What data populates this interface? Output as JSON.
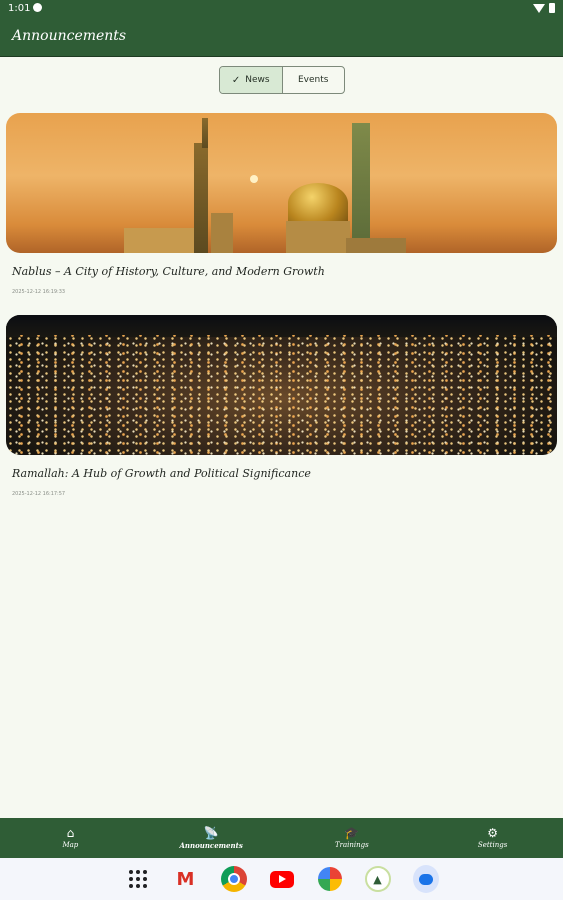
{
  "status_bar": {
    "time": "1:01"
  },
  "app_bar": {
    "title": "Announcements"
  },
  "segmented": {
    "options": [
      {
        "label": "News",
        "selected": true
      },
      {
        "label": "Events",
        "selected": false
      }
    ]
  },
  "feed": {
    "items": [
      {
        "title": "Nablus – A City of History, Culture, and Modern Growth",
        "date": "2025-12-12 16:19:33",
        "image": "mosque-sunset"
      },
      {
        "title": "Ramallah: A Hub of Growth and Political Significance",
        "date": "2025-12-12 16:17:57",
        "image": "city-night"
      }
    ]
  },
  "bottom_nav": {
    "items": [
      {
        "label": "Map",
        "icon": "home-icon",
        "active": false
      },
      {
        "label": "Announcements",
        "icon": "broadcast-icon",
        "active": true
      },
      {
        "label": "Trainings",
        "icon": "graduation-cap-icon",
        "active": false
      },
      {
        "label": "Settings",
        "icon": "gear-icon",
        "active": false
      }
    ]
  },
  "colors": {
    "primary": "#2f5d36",
    "background": "#f6f9f1",
    "segment_selected": "#d8e9d4"
  }
}
